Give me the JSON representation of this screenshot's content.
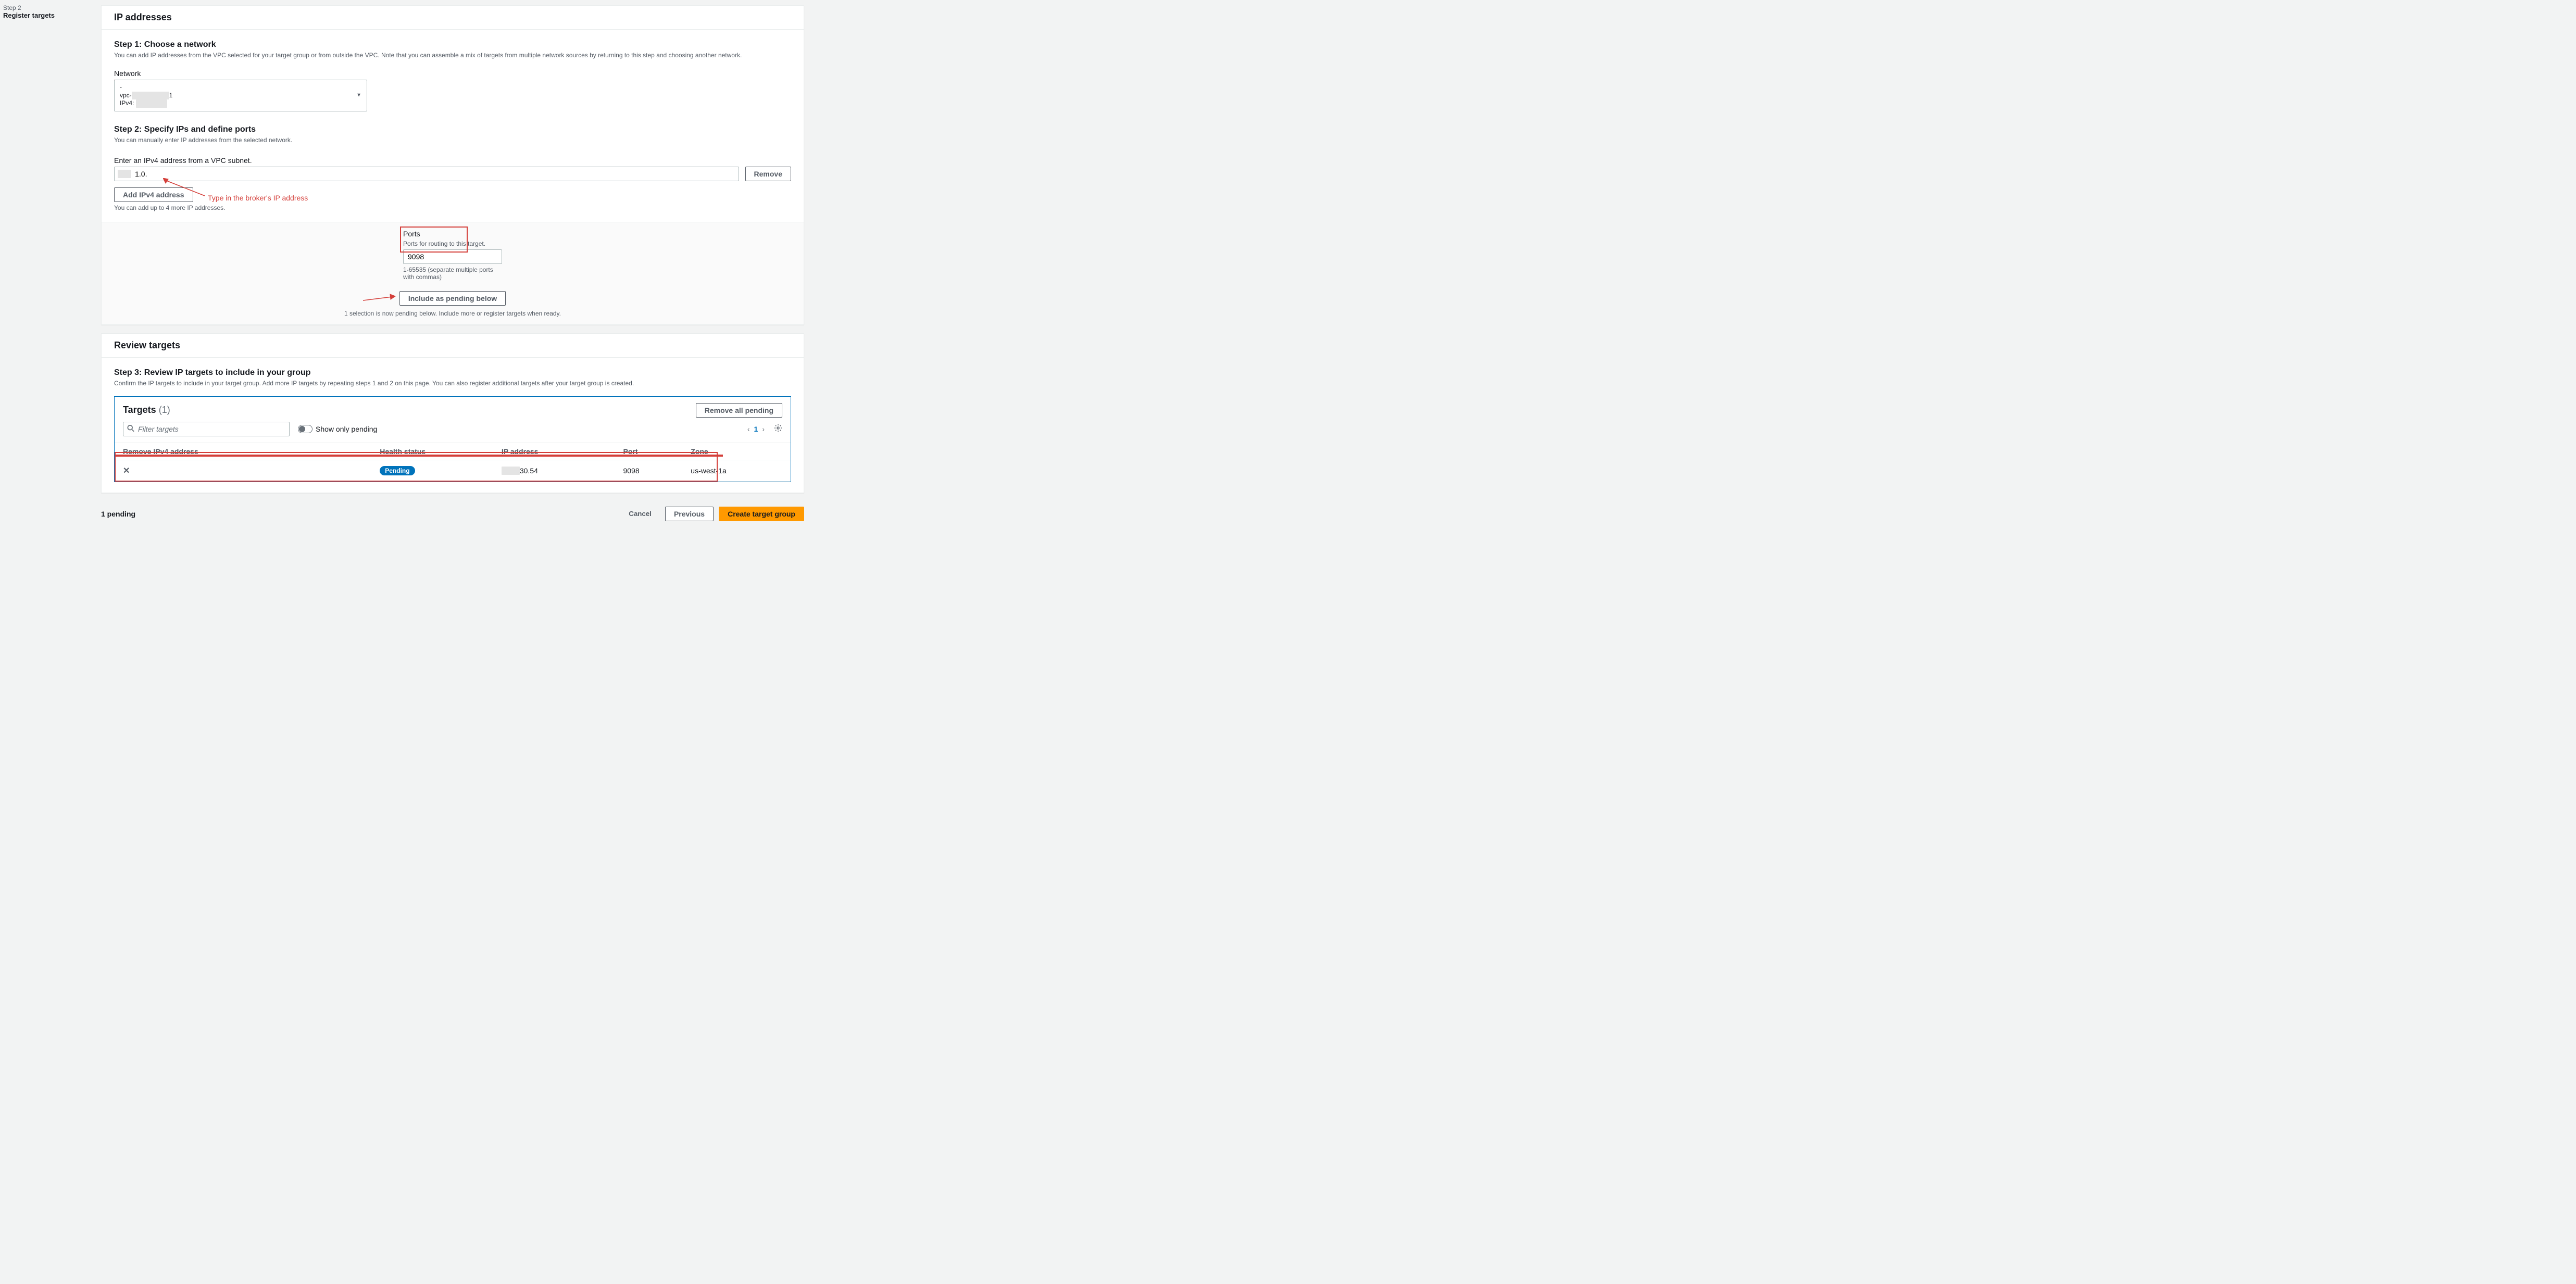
{
  "sidebar": {
    "step": "Step 2",
    "title": "Register targets"
  },
  "ip_panel": {
    "title": "IP addresses",
    "step1": {
      "heading": "Step 1: Choose a network",
      "desc": "You can add IP addresses from the VPC selected for your target group or from outside the VPC. Note that you can assemble a mix of targets from multiple network sources by returning to this step and choosing another network.",
      "network_label": "Network",
      "sel_line1": "-",
      "sel_line2_prefix": "vpc-",
      "sel_line2_suffix": "1",
      "sel_line3_prefix": "IPv4: "
    },
    "step2": {
      "heading": "Step 2: Specify IPs and define ports",
      "desc": "You can manually enter IP addresses from the selected network.",
      "enter_label": "Enter an IPv4 address from a VPC subnet.",
      "ip_value": "        1.0.",
      "remove_btn": "Remove",
      "add_btn": "Add IPv4 address",
      "add_help": "You can add up to 4 more IP addresses."
    },
    "annotation1": "Type in the broker's IP address",
    "ports": {
      "label": "Ports",
      "desc": "Ports for routing to this target.",
      "value": "9098",
      "hint": "1-65535 (separate multiple ports with commas)"
    },
    "include_btn": "Include as pending below",
    "pending_note": "1 selection is now pending below. Include more or register targets when ready."
  },
  "review": {
    "title": "Review targets",
    "step3": {
      "heading": "Step 3: Review IP targets to include in your group",
      "desc": "Confirm the IP targets to include in your target group. Add more IP targets by repeating steps 1 and 2 on this page. You can also register additional targets after your target group is created."
    },
    "targets_title": "Targets",
    "targets_count": "(1)",
    "remove_all": "Remove all pending",
    "search_ph": "Filter targets",
    "show_only": "Show only pending",
    "page": "1",
    "cols": {
      "remove": "Remove IPv4 address",
      "health": "Health status",
      "ip": "IP address",
      "port": "Port",
      "zone": "Zone"
    },
    "row": {
      "status": "Pending",
      "ip_suffix": "30.54",
      "port": "9098",
      "zone": "us-west-1a"
    }
  },
  "bottom": {
    "pending": "1 pending",
    "cancel": "Cancel",
    "previous": "Previous",
    "create": "Create target group"
  }
}
